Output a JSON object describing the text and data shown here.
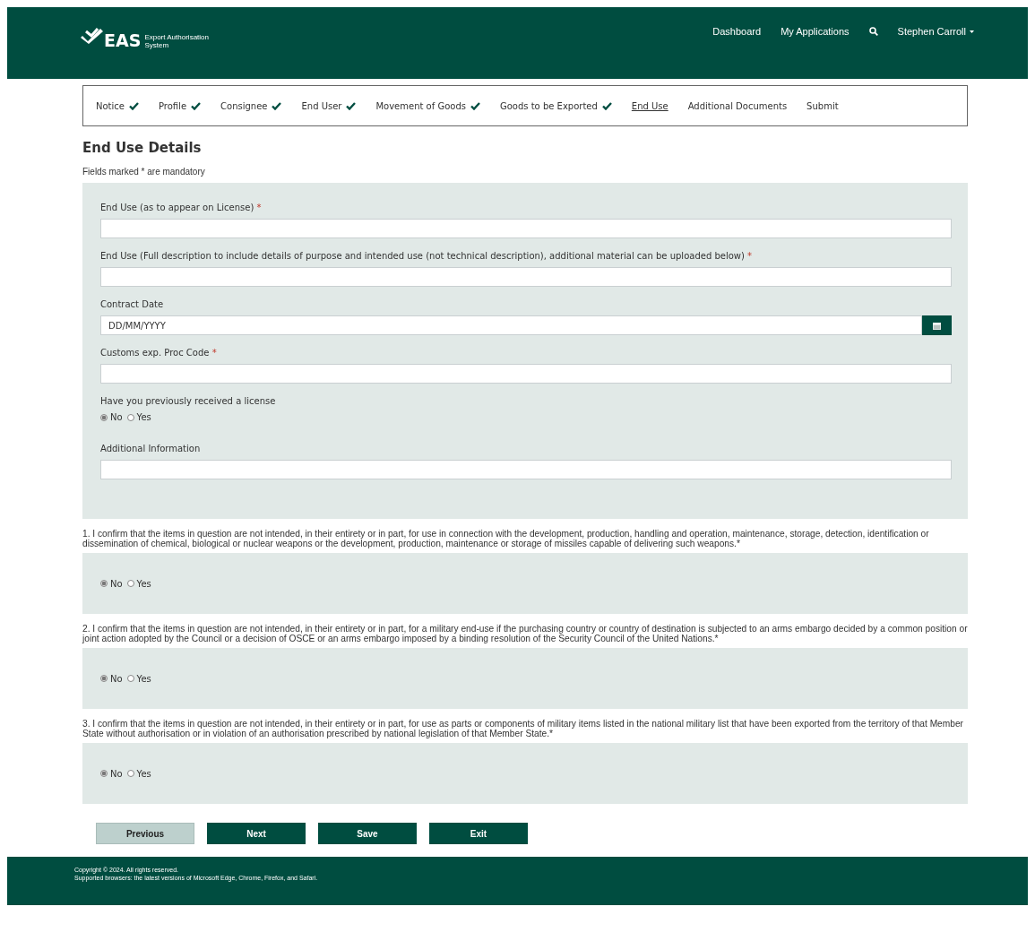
{
  "header": {
    "logo": {
      "mark": "EAS",
      "line_1": "Export Authorisation",
      "line_2": "System"
    },
    "nav": [
      "Dashboard",
      "My Applications"
    ],
    "user": "Stephen Carroll"
  },
  "steps": [
    {
      "label": "Notice",
      "done": true,
      "selected": false
    },
    {
      "label": "Profile",
      "done": true,
      "selected": false
    },
    {
      "label": "Consignee",
      "done": true,
      "selected": false
    },
    {
      "label": "End User",
      "done": true,
      "selected": false
    },
    {
      "label": "Movement of Goods",
      "done": true,
      "selected": false
    },
    {
      "label": "Goods to be Exported",
      "done": true,
      "selected": false
    },
    {
      "label": "End Use",
      "done": false,
      "selected": true
    },
    {
      "label": "Additional Documents",
      "done": false,
      "selected": false
    },
    {
      "label": "Submit",
      "done": false,
      "selected": false
    }
  ],
  "title": "End Use Details",
  "mandatory_note": "Fields marked * are mandatory",
  "fields": [
    {
      "kind": "text",
      "label": "End Use (as to appear on License)",
      "required_mark": "*"
    },
    {
      "kind": "text",
      "label": "End Use (Full description to include details of purpose and intended use (not technical description), additional material can be uploaded below)",
      "required_mark": "*"
    },
    {
      "kind": "date",
      "label": "Contract Date",
      "placeholder": "DD/MM/YYYY"
    },
    {
      "kind": "text",
      "label": "Customs exp. Proc Code",
      "required_mark": "*"
    },
    {
      "kind": "radio",
      "label": "Have you previously received a license",
      "options": [
        {
          "label": "No",
          "selected": true
        },
        {
          "label": "Yes",
          "selected": false
        }
      ]
    },
    {
      "kind": "text",
      "label": "Additional Information"
    }
  ],
  "questions": [
    {
      "text": "1. I confirm that the items in question are not intended, in their entirety or in part, for use in connection with the development, production, handling and operation, maintenance, storage, detection, identification or dissemination of chemical, biological or nuclear weapons or the development, production, maintenance or storage of missiles capable of delivering such weapons.*",
      "options": [
        {
          "label": "No",
          "selected": true
        },
        {
          "label": "Yes",
          "selected": false
        }
      ]
    },
    {
      "text": "2. I confirm that the items in question are not intended, in their entirety or in part, for a military end-use if the purchasing country or country of destination is subjected to an arms embargo decided by a common position or joint action adopted by the Council or a decision of OSCE or an arms embargo imposed by a binding resolution of the Security Council of the United Nations.*",
      "options": [
        {
          "label": "No",
          "selected": true
        },
        {
          "label": "Yes",
          "selected": false
        }
      ]
    },
    {
      "text": "3. I confirm that the items in question are not intended, in their entirety or in part, for use as parts or components of military items listed in the national military list that have been exported from the territory of that Member State without authorisation or in violation of an authorisation prescribed by national legislation of that Member State.*",
      "options": [
        {
          "label": "No",
          "selected": true
        },
        {
          "label": "Yes",
          "selected": false
        }
      ]
    }
  ],
  "buttons": [
    {
      "label": "Previous",
      "kind": "secondary"
    },
    {
      "label": "Next",
      "kind": "primary"
    },
    {
      "label": "Save",
      "kind": "primary"
    },
    {
      "label": "Exit",
      "kind": "primary"
    }
  ],
  "footer": [
    "Copyright © 2024. All rights reserved.",
    "Supported browsers: the latest versions of Microsoft Edge, Chrome, Firefox, and Safari."
  ]
}
